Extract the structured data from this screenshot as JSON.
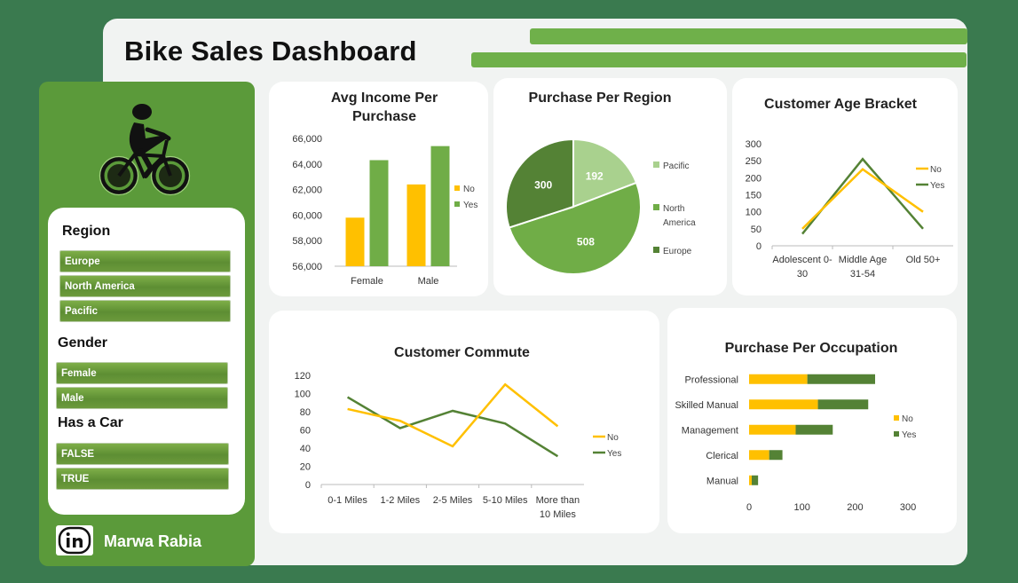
{
  "dashboard": {
    "title": "Bike Sales Dashboard",
    "author": "Marwa Rabia",
    "logo_icon": "linkedin-icon",
    "bike_icon": "cyclist-icon"
  },
  "colors": {
    "no": "#ffc000",
    "yes": "#70ad47",
    "yes_dark": "#548235",
    "panel": "#5b9a3a",
    "background": "#3a7a4f"
  },
  "slicers": {
    "region": {
      "title": "Region",
      "items": [
        "Europe",
        "North America",
        "Pacific"
      ]
    },
    "gender": {
      "title": "Gender",
      "items": [
        "Female",
        "Male"
      ]
    },
    "car": {
      "title": "Has a Car",
      "items": [
        "FALSE",
        "TRUE"
      ]
    }
  },
  "chart_data": [
    {
      "id": "income",
      "type": "bar",
      "title": "Avg Income Per Purchase",
      "categories": [
        "Female",
        "Male"
      ],
      "series": [
        {
          "name": "No",
          "values": [
            59800,
            62400
          ]
        },
        {
          "name": "Yes",
          "values": [
            64300,
            65400
          ]
        }
      ],
      "ylim": [
        56000,
        66000
      ],
      "yticks": [
        "56,000",
        "58,000",
        "60,000",
        "62,000",
        "64,000",
        "66,000"
      ],
      "legend_position": "right"
    },
    {
      "id": "region",
      "type": "pie",
      "title": "Purchase Per Region",
      "slices": [
        {
          "label": "Pacific",
          "value": 192
        },
        {
          "label": "North America",
          "value": 508
        },
        {
          "label": "Europe",
          "value": 300
        }
      ],
      "legend_position": "right"
    },
    {
      "id": "age",
      "type": "line",
      "title": "Customer Age Bracket",
      "categories": [
        "Adolescent 0-30",
        "Middle Age 31-54",
        "Old 50+"
      ],
      "series": [
        {
          "name": "No",
          "values": [
            50,
            225,
            100
          ]
        },
        {
          "name": "Yes",
          "values": [
            35,
            255,
            50
          ]
        }
      ],
      "ylim": [
        0,
        300
      ],
      "yticks": [
        "0",
        "50",
        "100",
        "150",
        "200",
        "250",
        "300"
      ],
      "legend_position": "right"
    },
    {
      "id": "commute",
      "type": "line",
      "title": "Customer Commute",
      "categories": [
        "0-1 Miles",
        "1-2 Miles",
        "2-5 Miles",
        "5-10 Miles",
        "More than 10 Miles"
      ],
      "series": [
        {
          "name": "No",
          "values": [
            83,
            70,
            42,
            110,
            64
          ]
        },
        {
          "name": "Yes",
          "values": [
            96,
            62,
            81,
            67,
            31
          ]
        }
      ],
      "ylim": [
        0,
        120
      ],
      "yticks": [
        "0",
        "20",
        "40",
        "60",
        "80",
        "100",
        "120"
      ],
      "legend_position": "right"
    },
    {
      "id": "occupation",
      "type": "bar",
      "orientation": "horizontal",
      "stacked": true,
      "title": "Purchase Per Occupation",
      "categories": [
        "Professional",
        "Skilled Manual",
        "Management",
        "Clerical",
        "Manual"
      ],
      "series": [
        {
          "name": "No",
          "values": [
            110,
            130,
            88,
            38,
            5
          ]
        },
        {
          "name": "Yes",
          "values": [
            128,
            95,
            70,
            25,
            12
          ]
        }
      ],
      "xlim": [
        0,
        300
      ],
      "xticks": [
        "0",
        "100",
        "200",
        "300"
      ],
      "legend_position": "right"
    }
  ]
}
